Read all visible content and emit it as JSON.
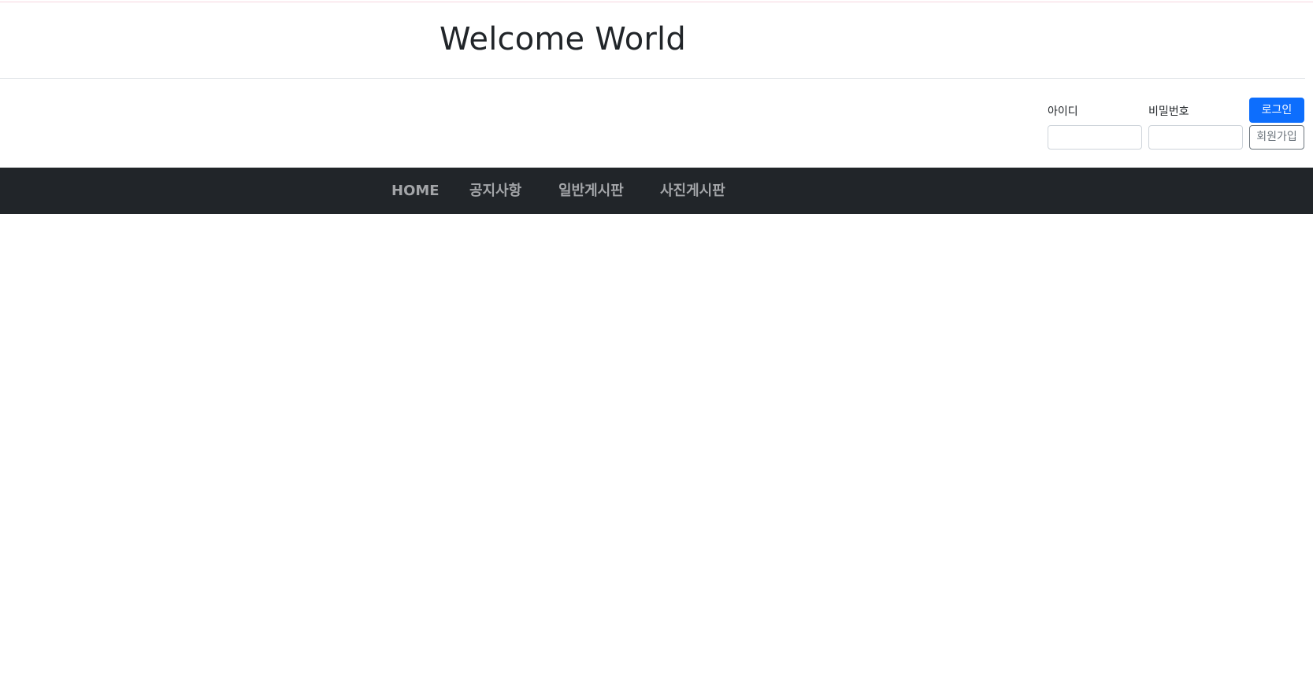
{
  "header": {
    "title": "Welcome World"
  },
  "login": {
    "id_label": "아이디",
    "id_value": "",
    "password_label": "비밀번호",
    "password_value": "",
    "login_button": "로그인",
    "signup_button": "회원가입"
  },
  "nav": {
    "items": [
      {
        "label": "HOME"
      },
      {
        "label": "공지사항"
      },
      {
        "label": "일반게시판"
      },
      {
        "label": "사진게시판"
      }
    ]
  },
  "colors": {
    "navbar_bg": "#212529",
    "nav_text": "#a3a5a8",
    "primary": "#0d6efd",
    "secondary": "#6c757d"
  }
}
